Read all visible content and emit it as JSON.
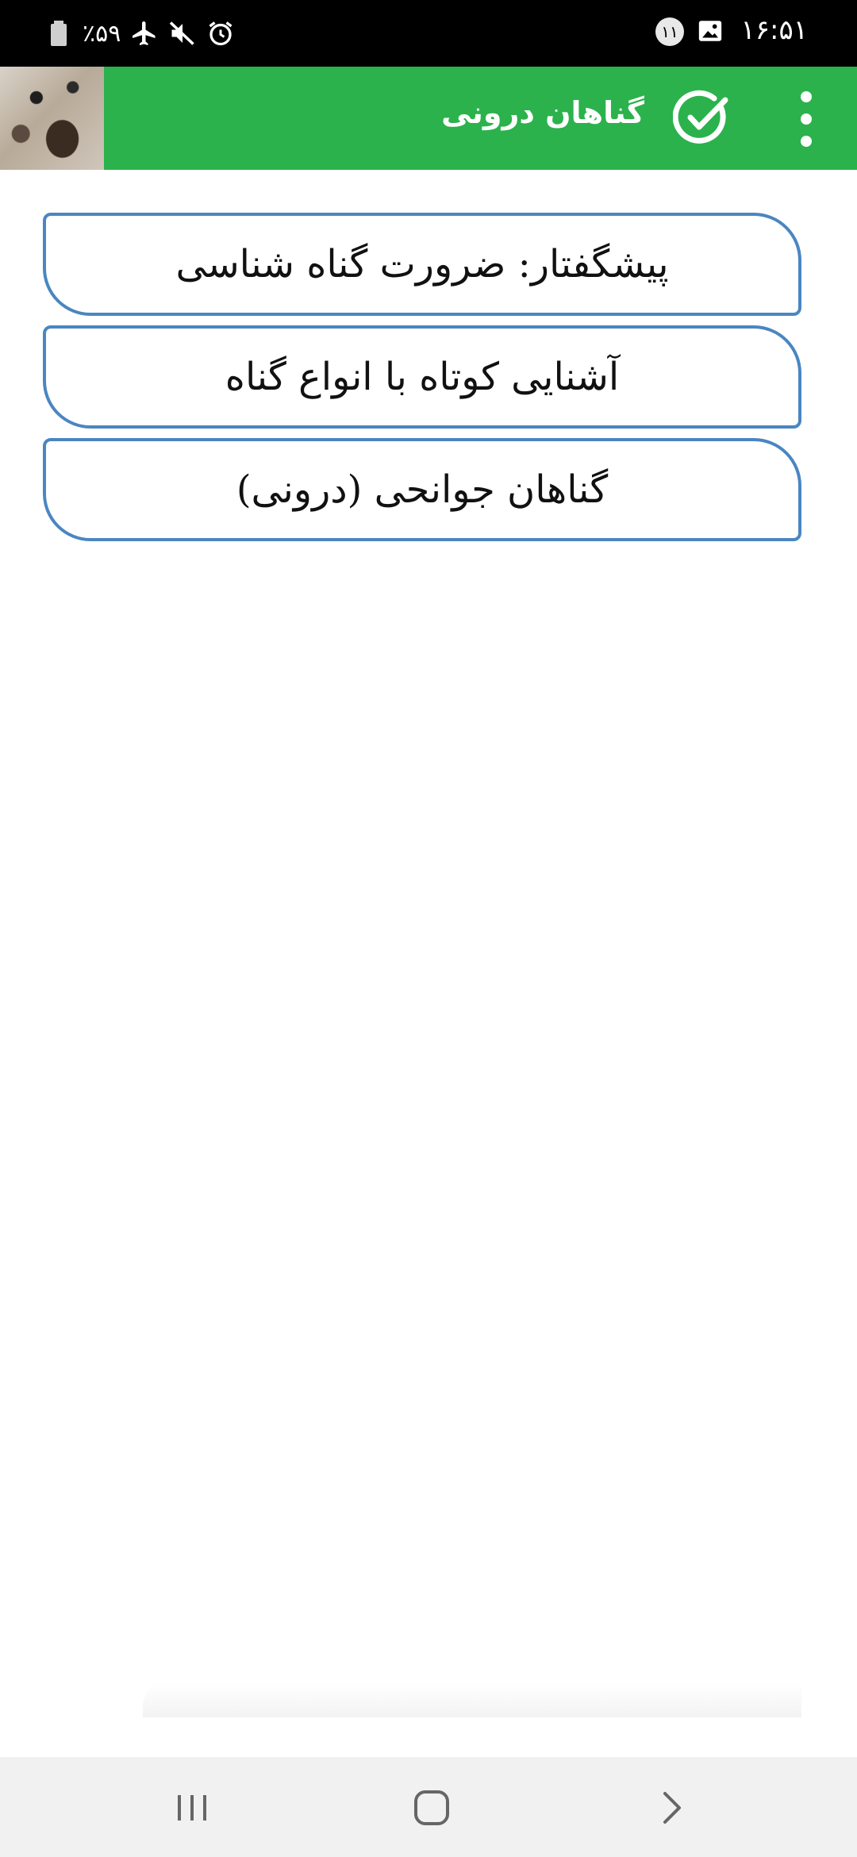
{
  "status_bar": {
    "time": "۱۶:۵۱",
    "notification_count": "۱۱",
    "battery_percent": "٪۵۹",
    "icons": [
      "gallery-icon",
      "notification-count-badge",
      "alarm-icon",
      "mute-icon",
      "airplane-icon",
      "battery-icon"
    ]
  },
  "app_bar": {
    "title": "گناهان درونی",
    "background": "#2bb24c",
    "icons": [
      "thumbnail-image",
      "check-circle-icon",
      "overflow-menu-icon"
    ]
  },
  "list": {
    "border_color": "#4a86c1",
    "items": [
      {
        "label": "پیشگفتار: ضرورت گناه شناسی"
      },
      {
        "label": "آشنایی کوتاه با انواع گناه"
      },
      {
        "label": "گناهان جوانحی (درونی)"
      }
    ]
  },
  "nav_bar": {
    "icons": [
      "recent-apps-icon",
      "home-icon",
      "back-icon"
    ]
  }
}
